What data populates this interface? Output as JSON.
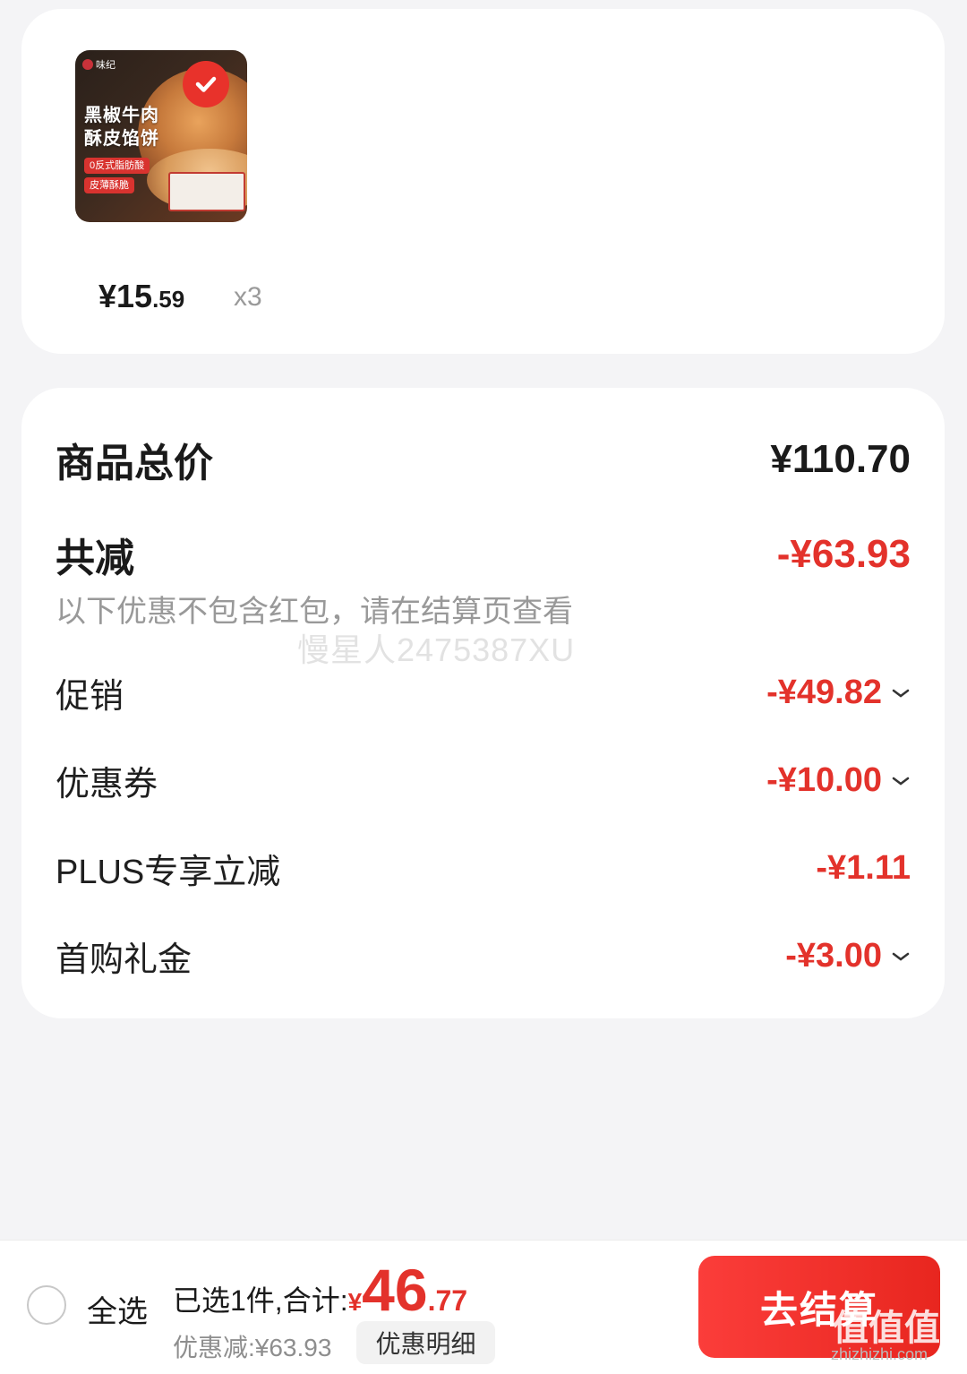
{
  "product": {
    "image": {
      "brand": "味纪",
      "title_line1": "黑椒牛肉",
      "title_line2": "酥皮馅饼",
      "tag1": "0反式脂肪酸",
      "tag2": "皮薄酥脆"
    },
    "price_int": "¥15",
    "price_dec": ".59",
    "quantity": "x3",
    "selected": true
  },
  "summary": {
    "total_label": "商品总价",
    "total_value": "¥110.70",
    "discount_label": "共减",
    "discount_value": "-¥63.93",
    "note": "以下优惠不包含红包，请在结算页查看",
    "watermark": "慢星人2475387XU",
    "items": [
      {
        "label": "促销",
        "value": "-¥49.82",
        "expandable": true
      },
      {
        "label": "优惠券",
        "value": "-¥10.00",
        "expandable": true
      },
      {
        "label": "PLUS专享立减",
        "value": "-¥1.11",
        "expandable": false
      },
      {
        "label": "首购礼金",
        "value": "-¥3.00",
        "expandable": true
      }
    ]
  },
  "bottom_bar": {
    "select_all": "全选",
    "selected_text": "已选1件,合计:",
    "currency": "¥",
    "total_int": "46",
    "total_dec": ".77",
    "savings": "优惠减:¥63.93",
    "detail_button": "优惠明细",
    "checkout_button": "去结算"
  },
  "overlay": {
    "site_mark": "值值值",
    "site_url": "zhizhizhi.com"
  },
  "colors": {
    "accent": "#e3322b",
    "background": "#f4f4f6"
  }
}
